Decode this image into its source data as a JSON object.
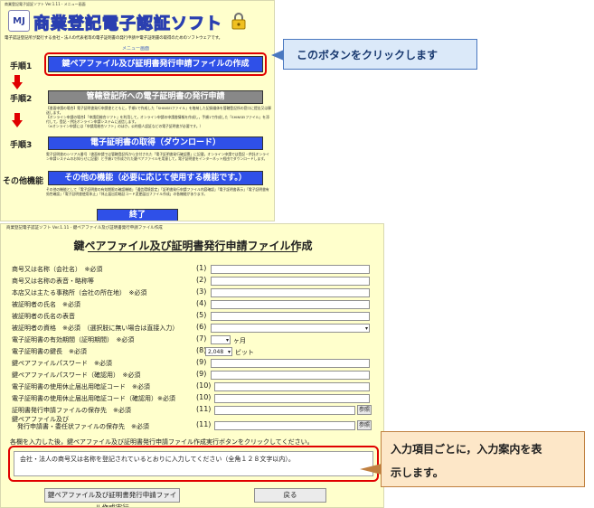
{
  "menu_window": {
    "title_bar": "商業登記電子認証ソフト Ver.1.11 - メニュー画面",
    "brand_logo": "MJ",
    "brand_title": "商業登記電子認証ソフト",
    "description": "電子認証登記所が発行する会社・法人の代表者等の電子証明書の発行申請や電子証明書の取得のためのソフトウェアです。",
    "caption": "メニュー画面",
    "steps": [
      {
        "label": "手順1",
        "button": "鍵ペアファイル及び証明書発行申請ファイルの作成",
        "button_style": "blue",
        "note": ""
      },
      {
        "label": "手順2",
        "button": "管轄登記所への電子証明書の発行申請",
        "button_style": "gray",
        "note": "【書面申請の場合】電子証明書発行申請書とともに，手順1で作成した「SHINSEIファイル」を格納した記録媒体を管轄登記所の窓口に提出又は郵送します。\n【オンライン申請の場合】「申請用総合ソフト」を利用して，オンライン申請の申請書情報を作成し，手順1で作成した「SHINSEIファイル」を添付して，登記・供託オンライン申請システムに送信します。\n（※オンライン申請には「申請用総合ソフト」のほか，公的個人認証などの電子証明書が必要です。）"
      },
      {
        "label": "手順3",
        "button": "電子証明書の取得（ダウンロード）",
        "button_style": "blue",
        "note": "電子証明書のシリアル番号（書面申請では管轄登記所から交付された「電子証明書発行確認票」に記載，オンライン申請では登記・供託オンライン申請システムのお知らせに記載）と手順1で作成された鍵ペアファイルを用意して，電子証明書をインターネット経由でダウンロードします。"
      },
      {
        "label": "その他機能",
        "button": "その他の機能（必要に応じて使用する機能です。）",
        "button_style": "blue",
        "note": "その他の機能として「電子証明書の有効期限の確認機能」「通信環境設定」「証明書発行申請ファイル内容確認」「電子証明書表示」「電子証明書有効性確認」「電子証明書使用休止」「休止届出用暗証コード変更届出ファイル作成」の各機能があります。"
      }
    ],
    "exit_button": "終了"
  },
  "callout_top": "このボタンをクリックします",
  "form_window": {
    "title_bar": "商業登記電子認証ソフト Ver.1.11 - 鍵ペアファイル及び証明書発行申請ファイル作成",
    "title": "鍵ペアファイル及び証明書発行申請ファイル作成",
    "fields": [
      {
        "label": "商号又は名称（会社名）　※必須",
        "num": "(1)",
        "type": "text",
        "value": ""
      },
      {
        "label": "商号又は名称の表音・略称等",
        "num": "(2)",
        "type": "text",
        "value": ""
      },
      {
        "label": "本店又は主たる事務所（会社の所在地）　※必須",
        "num": "(3)",
        "type": "text",
        "value": ""
      },
      {
        "label": "被証明者の氏名　※必須",
        "num": "(4)",
        "type": "text",
        "value": ""
      },
      {
        "label": "被証明者の氏名の表音",
        "num": "(5)",
        "type": "text",
        "value": ""
      },
      {
        "label": "被証明者の資格　※必須　（選択肢に無い場合は直接入力）",
        "num": "(6)",
        "type": "select-wide",
        "value": ""
      },
      {
        "label": "電子証明書の有効期間（証明期間）　※必須",
        "num": "(7)",
        "type": "select-unit",
        "value": "",
        "unit": "ヶ月"
      },
      {
        "label": "電子証明書の鍵長　※必須",
        "num": "(8)",
        "type": "select-unit",
        "value": "2,048",
        "unit": "ビット"
      },
      {
        "label": "鍵ペアファイルパスワード　※必須",
        "num": "(9)",
        "type": "text",
        "value": ""
      },
      {
        "label": "鍵ペアファイルパスワード（確認用）　※必須",
        "num": "(9)",
        "type": "text",
        "value": ""
      },
      {
        "label": "電子証明書の使用休止届出用暗証コード　※必須",
        "num": "(10)",
        "type": "text",
        "value": ""
      },
      {
        "label": "電子証明書の使用休止届出用暗証コード（確認用）※必須",
        "num": "(10)",
        "type": "text",
        "value": ""
      },
      {
        "label": "証明書発行申請ファイルの保存先　※必須",
        "num": "(11)",
        "type": "browse",
        "value": "",
        "button": "参照"
      },
      {
        "label": "鍵ペアファイル及び",
        "label2": "発行申請書・委任状ファイルの保存先　※必須",
        "num": "(11)",
        "type": "browse",
        "value": "",
        "button": "参照"
      }
    ],
    "guide_text": "各欄を入力した後，鍵ペアファイル及び証明書発行申請ファイル作成実行ボタンをクリックしてください。",
    "guide_box": "会社・法人の商号又は名称を登記されているとおりに入力してください（全角１２８文字以内）。",
    "exec_button": "鍵ペアファイル及び証明書発行申請ファイル作成実行",
    "back_button": "戻る"
  },
  "callout_bottom": "入力項目ごとに，入力案内を表\n示します。",
  "colors": {
    "window_bg": "#ffffcc",
    "menu_button_blue": "#2f50e8",
    "menu_button_gray": "#888888",
    "highlight_red": "#e00000",
    "callout_top_bg": "#dbe9f9",
    "callout_bottom_bg": "#fde7c8"
  },
  "icons": [
    "lock-icon",
    "down-arrow-icon",
    "callout-pointer"
  ]
}
